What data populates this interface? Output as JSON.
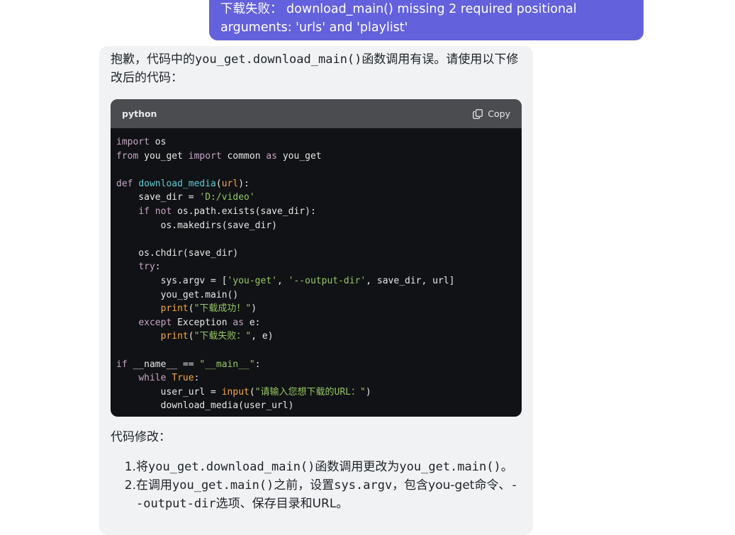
{
  "user_message": {
    "text": "下载失败： download_main() missing 2 required positional arguments: 'urls' and 'playlist'"
  },
  "assistant": {
    "intro": "抱歉，代码中的you_get.download_main()函数调用有误。请使用以下修改后的代码：",
    "code_block": {
      "language": "python",
      "copy_label": "Copy",
      "copy_icon": "copy-icon",
      "lines": [
        "import os",
        "from you_get import common as you_get",
        "",
        "def download_media(url):",
        "    save_dir = 'D:/video'",
        "    if not os.path.exists(save_dir):",
        "        os.makedirs(save_dir)",
        "",
        "    os.chdir(save_dir)",
        "    try:",
        "        sys.argv = ['you-get', '--output-dir', save_dir, url]",
        "        you_get.main()",
        "        print(\"下载成功！\")",
        "    except Exception as e:",
        "        print(\"下载失败：\", e)",
        "",
        "if __name__ == \"__main__\":",
        "    while True:",
        "        user_url = input(\"请输入您想下载的URL：\")",
        "        download_media(user_url)"
      ]
    },
    "changes_heading": "代码修改：",
    "changes": [
      {
        "number": "1.",
        "text": "将you_get.download_main()函数调用更改为you_get.main()。"
      },
      {
        "number": "2.",
        "text": "在调用you_get.main()之前，设置sys.argv，包含you-get命令、--output-dir选项、保存目录和URL。"
      }
    ]
  },
  "colors": {
    "user_bubble": "#6461dc",
    "assistant_card": "#f0f2f3",
    "code_background": "#111215",
    "code_header": "#4b4c50"
  }
}
